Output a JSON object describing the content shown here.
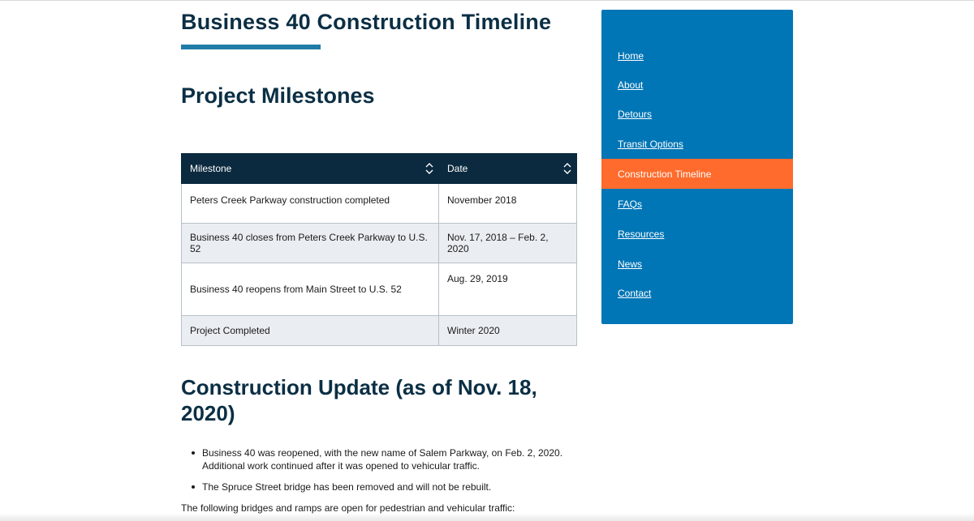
{
  "page": {
    "title": "Business 40 Construction Timeline",
    "section_title": "Project Milestones"
  },
  "table": {
    "headers": [
      "Milestone",
      "Date"
    ],
    "rows": [
      {
        "milestone": "Peters Creek Parkway construction completed",
        "date": "November 2018"
      },
      {
        "milestone": "Business 40 closes from Peters Creek Parkway to U.S. 52",
        "date": "Nov. 17, 2018 – Feb. 2, 2020"
      },
      {
        "milestone": "Business 40 reopens from Main Street to U.S. 52",
        "date": "Aug. 29, 2019"
      },
      {
        "milestone": "Project Completed",
        "date": "Winter 2020"
      }
    ]
  },
  "update": {
    "title": "Construction Update (as of Nov. 18, 2020)",
    "bullets": [
      "Business 40 was reopened, with the new name of Salem Parkway, on Feb. 2, 2020. Additional work continued after it was opened to vehicular traffic.",
      "The Spruce Street bridge has been removed and will not be rebuilt."
    ],
    "following": "The following bridges and ramps are open for pedestrian and vehicular traffic:"
  },
  "sidebar": {
    "items": [
      {
        "label": "Home"
      },
      {
        "label": "About"
      },
      {
        "label": "Detours"
      },
      {
        "label": "Transit Options"
      },
      {
        "label": "Construction Timeline"
      },
      {
        "label": "FAQs"
      },
      {
        "label": "Resources"
      },
      {
        "label": "News"
      },
      {
        "label": "Contact"
      }
    ],
    "active_item": "Construction Timeline",
    "background": "#0176b6",
    "active_color": "#ff6b2c"
  },
  "icons": {
    "sort": "sort-updown-icon"
  }
}
